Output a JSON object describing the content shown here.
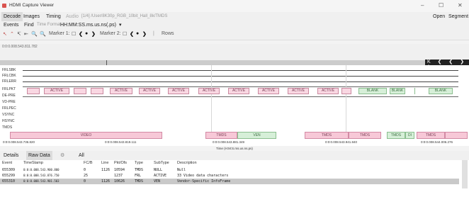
{
  "window": {
    "title": "HDMI Capture Viewer",
    "minimize": "–",
    "maximize": "☐",
    "close": "✕"
  },
  "menu": {
    "tabs": [
      "Decode",
      "Images",
      "Timing",
      "Audio"
    ],
    "path": "[1/4] /User/8K30p_RGB_10bit_Hall_8k/TMDS",
    "open": "Open",
    "segment": "Segment"
  },
  "events_bar": {
    "events": "Events",
    "find": "Find",
    "time_format_label": "Time Format",
    "time_format_value": "HH:MM:SS.ms.us.ns(.ps)",
    "dropdown": "▾"
  },
  "toolbar": {
    "marker1": "Marker 1:",
    "marker2": "Marker 2:",
    "rows": "Rows"
  },
  "ruler": {
    "timestamp": "0:0:0.008.543.811.782"
  },
  "signals": [
    "FRLSBK",
    "FRLCBK",
    "FRLERR",
    "FRLPKT",
    "DE-PRE",
    "VD-PRE",
    "FRLPEC",
    "VSYNC",
    "HSYNC",
    "TMDS"
  ],
  "packets": [
    "ACTIVE",
    "ACTIVE",
    "ACTIVE",
    "ACTIVE",
    "ACTIVE",
    "ACTIVE",
    "ACTIVE",
    "ACTIVE",
    "ACTIVE",
    "ACTIVE",
    "BLANK",
    "BLANK",
    "BLANK"
  ],
  "bars": [
    "VIDEO",
    "TMDS",
    "VEN",
    "TMDS",
    "TMDS",
    "TMDS",
    "DI",
    "TMDS"
  ],
  "ticks": [
    "0:0:0.008.543.736.820",
    "0:0:0.008.543.819.111",
    "0:0:0.008.543.881.349",
    "0:0:0.008.543.941.840",
    "0:0:0.008.544.006.276"
  ],
  "time_caption": "Time (H:M:S.ms.us.ns.ps)",
  "bottom_tabs": {
    "details": "Details",
    "raw_data": "Raw Data",
    "all": "All"
  },
  "table": {
    "headers": [
      "Event",
      "TimeStamp",
      "FC/B",
      "Line",
      "Pkt/Ofs",
      "Type",
      "SubType",
      "Description"
    ],
    "rows": [
      [
        "655309",
        "0:0:0.008.543.900.800",
        "0",
        "1126",
        "10594",
        "TMDS",
        "NULL",
        "Null"
      ],
      [
        "655299",
        "0:0:0.008.543.876.750",
        "25",
        "",
        "1237",
        "FRL",
        "ACTIVE",
        "33 Video data characters"
      ],
      [
        "655310",
        "0:0:0.008.543.901.503",
        "0",
        "1126",
        "10626",
        "TMDS",
        "VEN",
        "Vendor-Specific InfoFrame"
      ]
    ]
  }
}
